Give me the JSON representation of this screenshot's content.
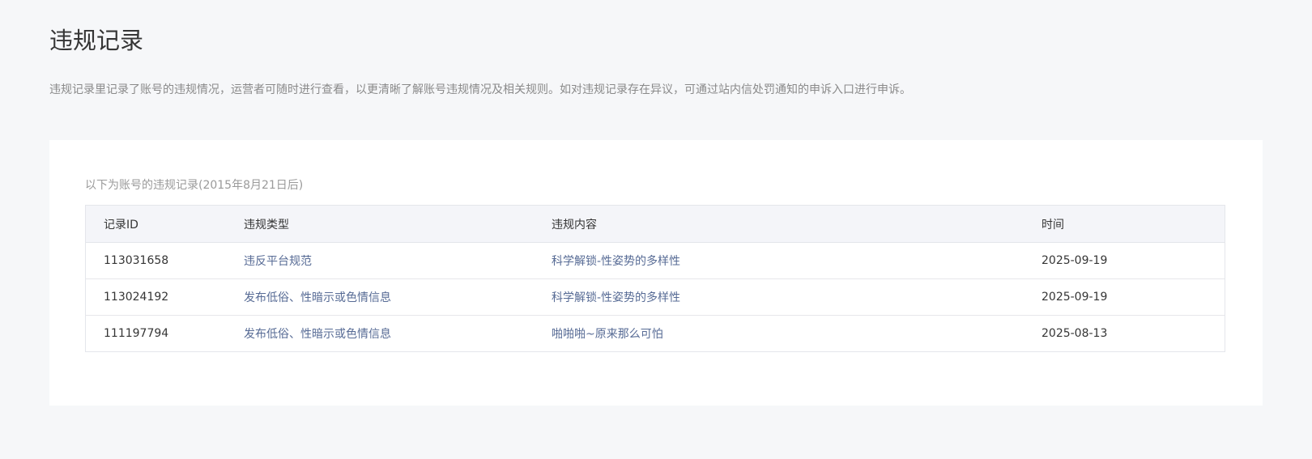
{
  "page": {
    "title": "违规记录",
    "description": "违规记录里记录了账号的违规情况，运营者可随时进行查看，以更清晰了解账号违规情况及相关规则。如对违规记录存在异议，可通过站内信处罚通知的申诉入口进行申诉。"
  },
  "records": {
    "caption": "以下为账号的违规记录(2015年8月21日后)",
    "columns": [
      "记录ID",
      "违规类型",
      "违规内容",
      "时间"
    ],
    "rows": [
      {
        "id": "113031658",
        "type": "违反平台规范",
        "content": "科学解锁-性姿势的多样性",
        "time": "2025-09-19"
      },
      {
        "id": "113024192",
        "type": "发布低俗、性暗示或色情信息",
        "content": "科学解锁-性姿势的多样性",
        "time": "2025-09-19"
      },
      {
        "id": "111197794",
        "type": "发布低俗、性暗示或色情信息",
        "content": "啪啪啪~原来那么可怕",
        "time": "2025-08-13"
      }
    ]
  },
  "colors": {
    "background": "#f6f7f9",
    "card": "#ffffff",
    "link": "#576b95",
    "header_bg": "#f4f5f9",
    "text": "#353535",
    "muted": "#8a8a8a"
  }
}
